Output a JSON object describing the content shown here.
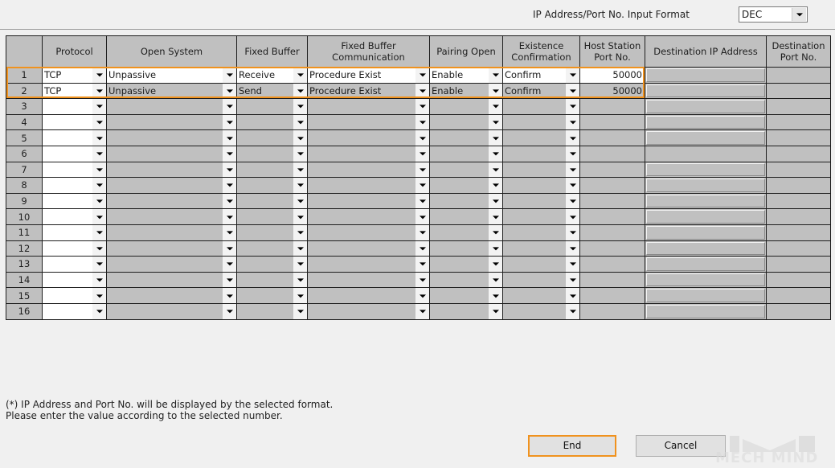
{
  "format": {
    "label": "IP Address/Port No. Input Format",
    "value": "DEC"
  },
  "table": {
    "headers": [
      "",
      "Protocol",
      "Open System",
      "Fixed Buffer",
      "Fixed Buffer Communication",
      "Pairing Open",
      "Existence Confirmation",
      "Host Station Port No.",
      "Destination IP Address",
      "Destination Port No."
    ],
    "rows": [
      {
        "no": "1",
        "protocol": "TCP",
        "open_system": "Unpassive",
        "fixed_buffer": "Receive",
        "fb_comm": "Procedure Exist",
        "pairing": "Enable",
        "existence": "Confirm",
        "host_port": "50000",
        "dest_ip": "",
        "dest_port": ""
      },
      {
        "no": "2",
        "protocol": "TCP",
        "open_system": "Unpassive",
        "fixed_buffer": "Send",
        "fb_comm": "Procedure Exist",
        "pairing": "Enable",
        "existence": "Confirm",
        "host_port": "50000",
        "dest_ip": "",
        "dest_port": ""
      },
      {
        "no": "3",
        "protocol": "",
        "open_system": "",
        "fixed_buffer": "",
        "fb_comm": "",
        "pairing": "",
        "existence": "",
        "host_port": "",
        "dest_ip": "",
        "dest_port": ""
      },
      {
        "no": "4",
        "protocol": "",
        "open_system": "",
        "fixed_buffer": "",
        "fb_comm": "",
        "pairing": "",
        "existence": "",
        "host_port": "",
        "dest_ip": "",
        "dest_port": ""
      },
      {
        "no": "5",
        "protocol": "",
        "open_system": "",
        "fixed_buffer": "",
        "fb_comm": "",
        "pairing": "",
        "existence": "",
        "host_port": "",
        "dest_ip": "",
        "dest_port": ""
      },
      {
        "no": "6",
        "protocol": "",
        "open_system": "",
        "fixed_buffer": "",
        "fb_comm": "",
        "pairing": "",
        "existence": "",
        "host_port": "",
        "dest_ip": "",
        "dest_port": ""
      },
      {
        "no": "7",
        "protocol": "",
        "open_system": "",
        "fixed_buffer": "",
        "fb_comm": "",
        "pairing": "",
        "existence": "",
        "host_port": "",
        "dest_ip": "",
        "dest_port": ""
      },
      {
        "no": "8",
        "protocol": "",
        "open_system": "",
        "fixed_buffer": "",
        "fb_comm": "",
        "pairing": "",
        "existence": "",
        "host_port": "",
        "dest_ip": "",
        "dest_port": ""
      },
      {
        "no": "9",
        "protocol": "",
        "open_system": "",
        "fixed_buffer": "",
        "fb_comm": "",
        "pairing": "",
        "existence": "",
        "host_port": "",
        "dest_ip": "",
        "dest_port": ""
      },
      {
        "no": "10",
        "protocol": "",
        "open_system": "",
        "fixed_buffer": "",
        "fb_comm": "",
        "pairing": "",
        "existence": "",
        "host_port": "",
        "dest_ip": "",
        "dest_port": ""
      },
      {
        "no": "11",
        "protocol": "",
        "open_system": "",
        "fixed_buffer": "",
        "fb_comm": "",
        "pairing": "",
        "existence": "",
        "host_port": "",
        "dest_ip": "",
        "dest_port": ""
      },
      {
        "no": "12",
        "protocol": "",
        "open_system": "",
        "fixed_buffer": "",
        "fb_comm": "",
        "pairing": "",
        "existence": "",
        "host_port": "",
        "dest_ip": "",
        "dest_port": ""
      },
      {
        "no": "13",
        "protocol": "",
        "open_system": "",
        "fixed_buffer": "",
        "fb_comm": "",
        "pairing": "",
        "existence": "",
        "host_port": "",
        "dest_ip": "",
        "dest_port": ""
      },
      {
        "no": "14",
        "protocol": "",
        "open_system": "",
        "fixed_buffer": "",
        "fb_comm": "",
        "pairing": "",
        "existence": "",
        "host_port": "",
        "dest_ip": "",
        "dest_port": ""
      },
      {
        "no": "15",
        "protocol": "",
        "open_system": "",
        "fixed_buffer": "",
        "fb_comm": "",
        "pairing": "",
        "existence": "",
        "host_port": "",
        "dest_ip": "",
        "dest_port": ""
      },
      {
        "no": "16",
        "protocol": "",
        "open_system": "",
        "fixed_buffer": "",
        "fb_comm": "",
        "pairing": "",
        "existence": "",
        "host_port": "",
        "dest_ip": "",
        "dest_port": ""
      }
    ],
    "highlight_color": "#f0921e"
  },
  "note": {
    "line1": "(*) IP Address and Port No. will be displayed by the selected format.",
    "line2": "Please enter the value according to the selected number."
  },
  "buttons": {
    "end": "End",
    "cancel": "Cancel"
  },
  "watermark": "MECH MIND"
}
